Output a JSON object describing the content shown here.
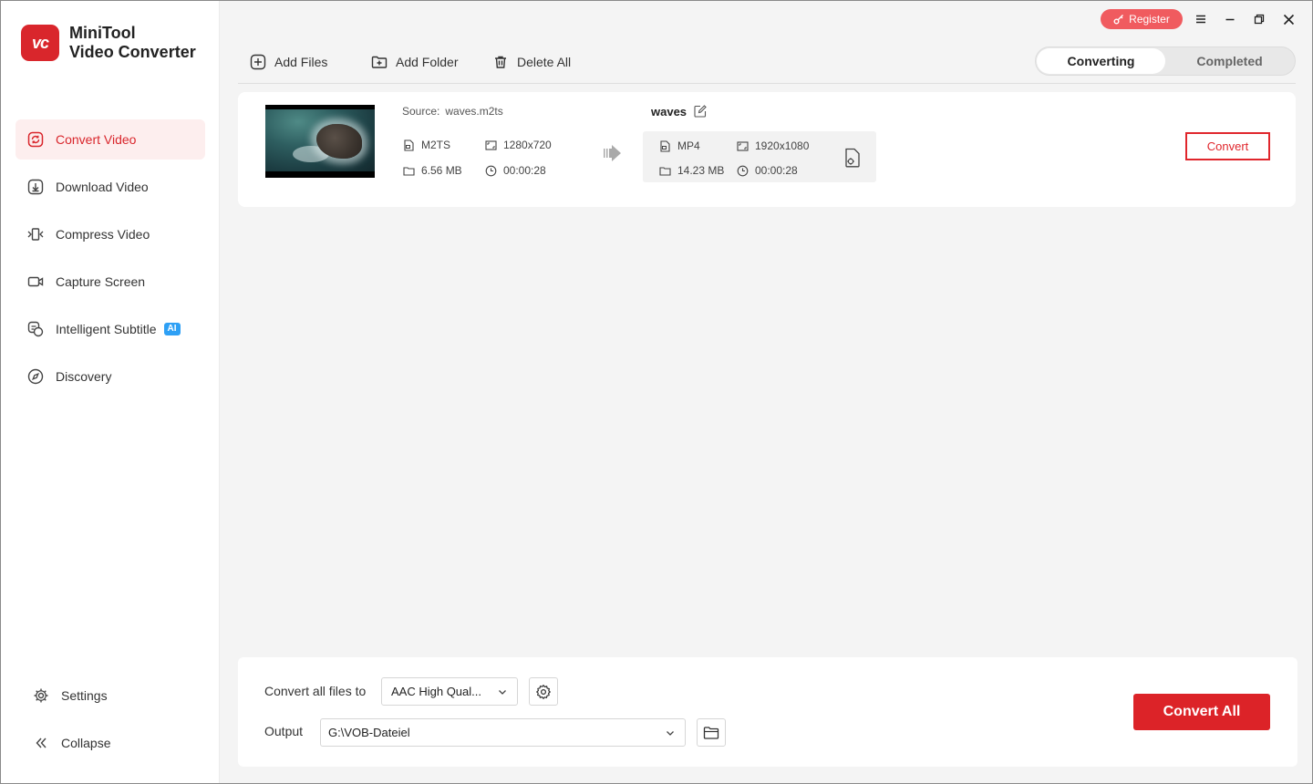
{
  "app": {
    "name_line1": "MiniTool",
    "name_line2": "Video Converter",
    "logo_text": "vc",
    "accent_color": "#d9262c"
  },
  "titlebar": {
    "register_label": "Register",
    "register_icon": "key-icon",
    "menu_icon": "hamburger-menu-icon",
    "minimize_icon": "minimize-icon",
    "restore_icon": "restore-icon",
    "close_icon": "close-icon"
  },
  "sidebar": {
    "items": [
      {
        "label": "Convert Video",
        "icon": "convert-video-icon",
        "active": true
      },
      {
        "label": "Download Video",
        "icon": "download-icon"
      },
      {
        "label": "Compress Video",
        "icon": "compress-icon"
      },
      {
        "label": "Capture Screen",
        "icon": "camera-icon"
      },
      {
        "label": "Intelligent Subtitle",
        "icon": "subtitle-icon",
        "badge": "AI"
      },
      {
        "label": "Discovery",
        "icon": "compass-icon"
      }
    ],
    "settings_label": "Settings",
    "collapse_label": "Collapse"
  },
  "toolbar": {
    "add_files": "Add Files",
    "add_folder": "Add Folder",
    "delete_all": "Delete All"
  },
  "tabs": {
    "converting": "Converting",
    "completed": "Completed",
    "active": "converting"
  },
  "file": {
    "source_label": "Source:",
    "source_name": "waves.m2ts",
    "source": {
      "format": "M2TS",
      "resolution": "1280x720",
      "size": "6.56 MB",
      "duration": "00:00:28"
    },
    "output_name": "waves",
    "output": {
      "format": "MP4",
      "resolution": "1920x1080",
      "size": "14.23 MB",
      "duration": "00:00:28"
    },
    "convert_label": "Convert"
  },
  "bottom": {
    "convert_all_files_to_label": "Convert all files to",
    "format_value": "AAC High Qual...",
    "output_label": "Output",
    "output_path": "G:\\VOB-Dateiel",
    "convert_all_label": "Convert All"
  }
}
